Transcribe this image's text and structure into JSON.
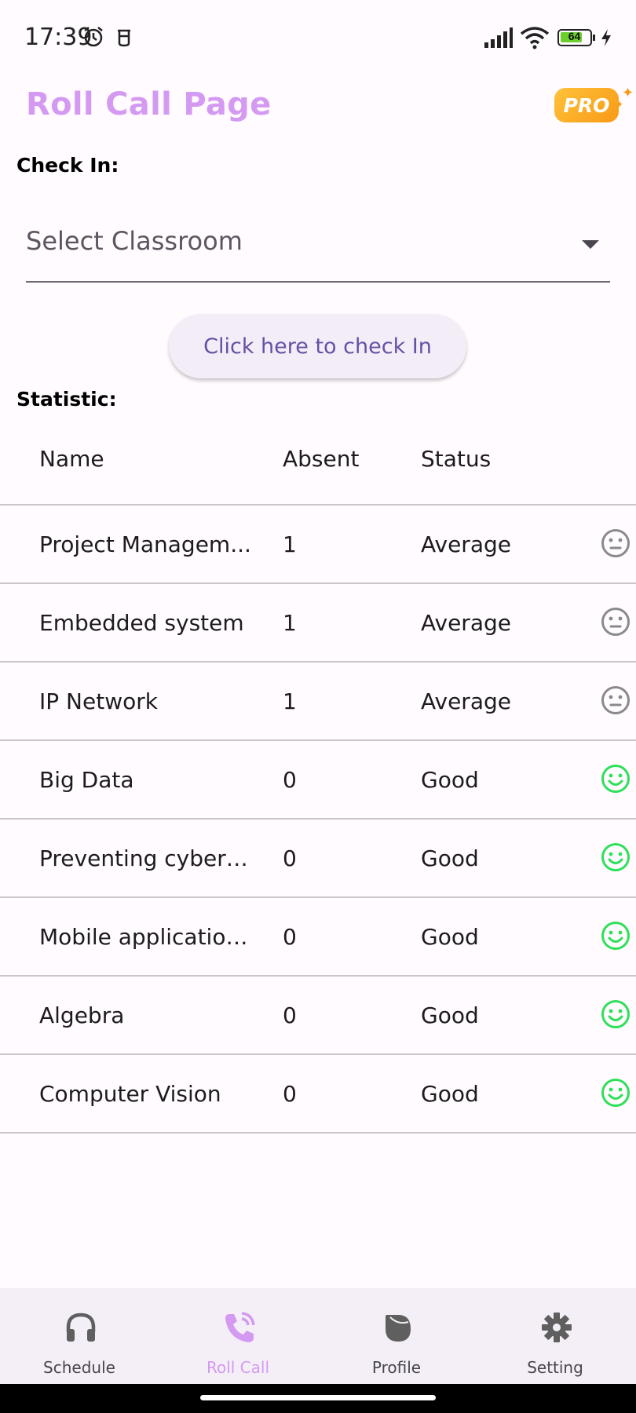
{
  "status_bar": {
    "time": "17:39",
    "battery": "64"
  },
  "header": {
    "title": "Roll Call Page",
    "badge": "PRO"
  },
  "check_in": {
    "label": "Check In:",
    "dropdown_placeholder": "Select Classroom",
    "button_label": "Click here to check In"
  },
  "statistic": {
    "label": "Statistic:",
    "columns": [
      "Name",
      "Absent",
      "Status"
    ],
    "rows": [
      {
        "name": "Project Managem...",
        "absent": "1",
        "status": "Average",
        "mood": "neutral"
      },
      {
        "name": "Embedded system",
        "absent": "1",
        "status": "Average",
        "mood": "neutral"
      },
      {
        "name": "IP Network",
        "absent": "1",
        "status": "Average",
        "mood": "neutral"
      },
      {
        "name": "Big Data",
        "absent": "0",
        "status": "Good",
        "mood": "happy"
      },
      {
        "name": "Preventing cyber a...",
        "absent": "0",
        "status": "Good",
        "mood": "happy"
      },
      {
        "name": "Mobile application...",
        "absent": "0",
        "status": "Good",
        "mood": "happy"
      },
      {
        "name": "Algebra",
        "absent": "0",
        "status": "Good",
        "mood": "happy"
      },
      {
        "name": "Computer Vision",
        "absent": "0",
        "status": "Good",
        "mood": "happy"
      }
    ]
  },
  "bottom_nav": [
    {
      "label": "Schedule",
      "icon": "headphones-icon",
      "active": false
    },
    {
      "label": "Roll Call",
      "icon": "phone-call-icon",
      "active": true
    },
    {
      "label": "Profile",
      "icon": "profile-icon",
      "active": false
    },
    {
      "label": "Setting",
      "icon": "gear-icon",
      "active": false
    }
  ],
  "colors": {
    "accent": "#d49af2",
    "button_text": "#6750a4",
    "neutral_face": "#8a8a8a",
    "happy_face": "#2ee05a",
    "pro_badge": "#f79a16"
  }
}
